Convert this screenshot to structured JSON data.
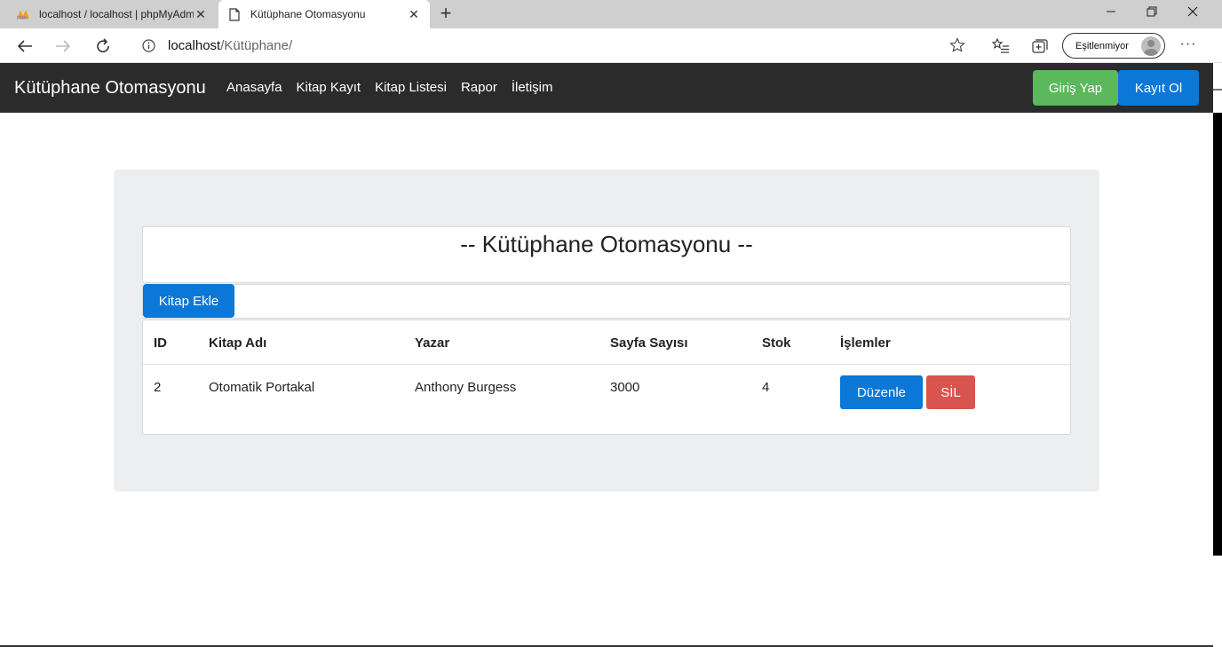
{
  "browser": {
    "tabs": [
      {
        "title": "localhost / localhost | phpMyAdmin",
        "favicon": "phpmyadmin-icon"
      },
      {
        "title": "Kütüphane Otomasyonu",
        "favicon": "page-icon"
      }
    ],
    "url": {
      "host": "localhost",
      "path": "/Kütüphane/"
    },
    "sync_label": "Eşitlenmiyor"
  },
  "site": {
    "brand": "Kütüphane Otomasyonu",
    "nav": [
      "Anasayfa",
      "Kitap Kayıt",
      "Kitap Listesi",
      "Rapor",
      "İletişim"
    ],
    "login_label": "Giriş Yap",
    "register_label": "Kayıt Ol",
    "colors": {
      "success": "#5cb85c",
      "primary": "#0b78d7",
      "danger": "#d9534f",
      "navbar": "#2b2b2b"
    }
  },
  "main": {
    "heading": "-- Kütüphane Otomasyonu --",
    "add_button": "Kitap Ekle",
    "table": {
      "headers": [
        "ID",
        "Kitap Adı",
        "Yazar",
        "Sayfa Sayısı",
        "Stok",
        "İşlemler"
      ],
      "rows": [
        {
          "id": "2",
          "title": "Otomatik Portakal",
          "author": "Anthony Burgess",
          "pages": "3000",
          "stock": "4"
        }
      ],
      "edit_label": "Düzenle",
      "delete_label": "SİL"
    }
  }
}
